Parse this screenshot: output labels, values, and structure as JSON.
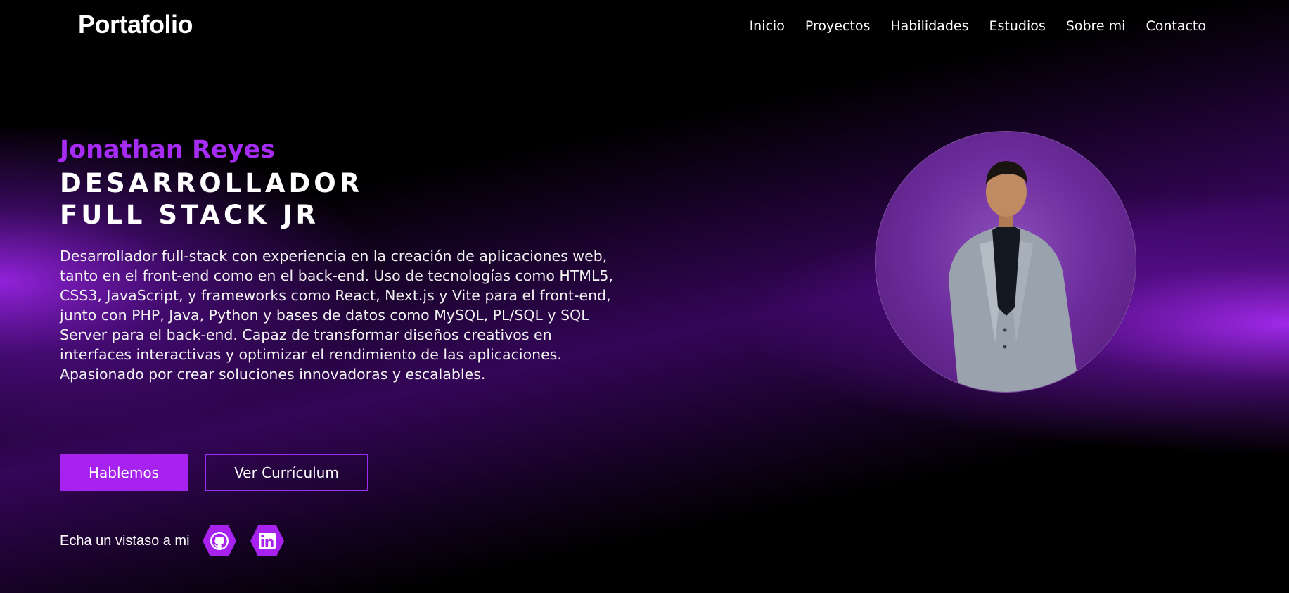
{
  "navbar": {
    "logo": "Portafolio",
    "links": [
      "Inicio",
      "Proyectos",
      "Habilidades",
      "Estudios",
      "Sobre mi",
      "Contacto"
    ]
  },
  "hero": {
    "name": "Jonathan Reyes",
    "role_line1": "DESARROLLADOR",
    "role_line2": "FULL STACK JR",
    "description": "Desarrollador full-stack con experiencia en la creación de aplicaciones web, tanto en el front-end como en el back-end. Uso de tecnologías como HTML5, CSS3, JavaScript, y frameworks como React, Next.js y Vite para el front-end, junto con PHP, Java, Python y bases de datos como MySQL, PL/SQL y SQL Server para el back-end. Capaz de transformar diseños creativos en interfaces interactivas y optimizar el rendimiento de las aplicaciones. Apasionado por crear soluciones innovadoras y escalables.",
    "primary_button": "Hablemos",
    "secondary_button": "Ver Currículum"
  },
  "social": {
    "label": "Echa un vistaso a mi",
    "icons": [
      "github-icon",
      "linkedin-icon"
    ]
  },
  "colors": {
    "accent": "#a722ef",
    "name": "#a62cf5",
    "background": "#000000"
  }
}
